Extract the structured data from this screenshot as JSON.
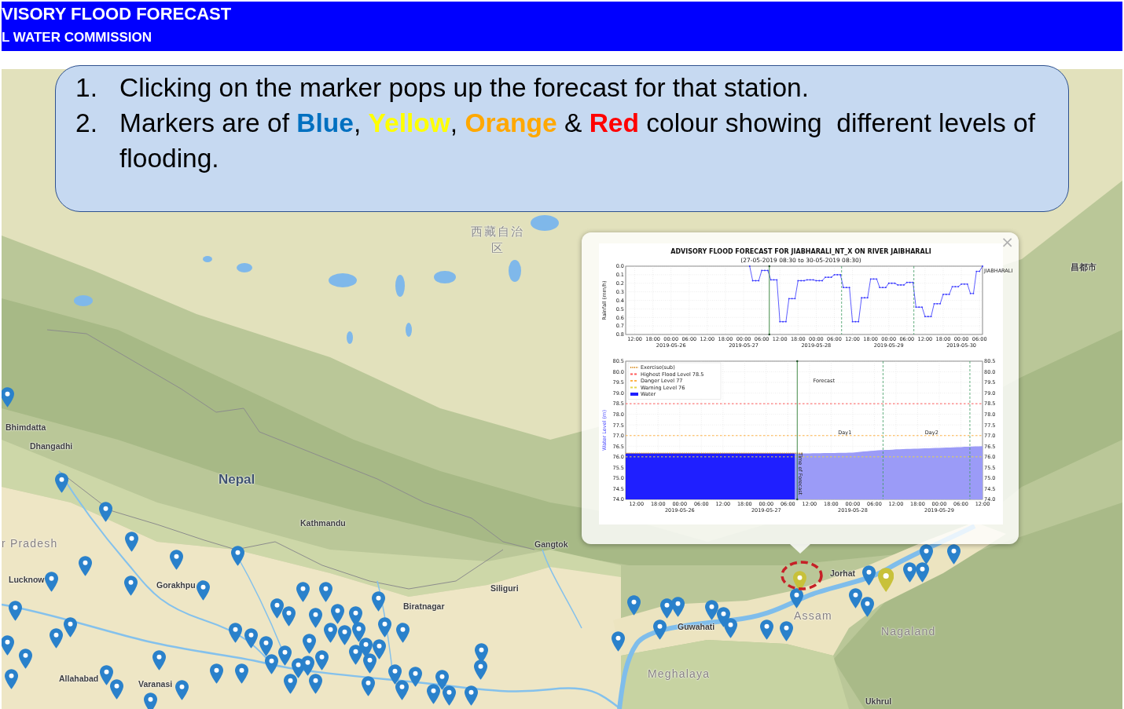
{
  "header": {
    "title": "VISORY FLOOD FORECAST",
    "subtitle": "L WATER COMMISSION"
  },
  "callout": {
    "items": [
      {
        "number": "1.",
        "segments": [
          {
            "text": "Clicking on the marker pops up the forecast for that station."
          }
        ]
      },
      {
        "number": "2.",
        "segments": [
          {
            "text": "Markers are of "
          },
          {
            "text": "**Blue**",
            "color": "#0070c0"
          },
          {
            "text": ", "
          },
          {
            "text": "**Yellow**",
            "color": "#ffff00"
          },
          {
            "text": ", "
          },
          {
            "text": "**Orange**",
            "color": "#ffa800"
          },
          {
            "text": " & "
          },
          {
            "text": "**Red**",
            "color": "#ff0000"
          },
          {
            "text": " colour showing  different levels of flooding."
          }
        ]
      }
    ]
  },
  "map": {
    "labels": [
      {
        "text": "西藏自治区",
        "kind": "region"
      },
      {
        "text": "昌都市",
        "kind": "city"
      },
      {
        "text": "Bhimdatta",
        "kind": "city"
      },
      {
        "text": "Dhangadhi",
        "kind": "city"
      },
      {
        "text": "Nepal",
        "kind": "country"
      },
      {
        "text": "Kathmandu",
        "kind": "city"
      },
      {
        "text": "r Pradesh",
        "kind": "state"
      },
      {
        "text": "Gangtok",
        "kind": "city"
      },
      {
        "text": "Lucknow",
        "kind": "city"
      },
      {
        "text": "Gorakhpu",
        "kind": "city"
      },
      {
        "text": "Jorhat",
        "kind": "city"
      },
      {
        "text": "Siliguri",
        "kind": "city"
      },
      {
        "text": "Biratnagar",
        "kind": "city"
      },
      {
        "text": "Assam",
        "kind": "state"
      },
      {
        "text": "Guwahati",
        "kind": "city"
      },
      {
        "text": "Nagaland",
        "kind": "state"
      },
      {
        "text": "Meghalaya",
        "kind": "state"
      },
      {
        "text": "Allahabad",
        "kind": "city"
      },
      {
        "text": "Varanasi",
        "kind": "city"
      },
      {
        "text": "Ukhrul",
        "kind": "city"
      }
    ],
    "markers": [
      {
        "color": "#2a81cb",
        "selected": false
      },
      {
        "color": "#2a81cb",
        "selected": false
      },
      {
        "color": "#2a81cb",
        "selected": false
      },
      {
        "color": "#2a81cb",
        "selected": false
      },
      {
        "color": "#2a81cb",
        "selected": false
      },
      {
        "color": "#2a81cb",
        "selected": false
      },
      {
        "color": "#2a81cb",
        "selected": false
      },
      {
        "color": "#2a81cb",
        "selected": false
      },
      {
        "color": "#2a81cb",
        "selected": false
      },
      {
        "color": "#2a81cb",
        "selected": false
      },
      {
        "color": "#2a81cb",
        "selected": false
      },
      {
        "color": "#2a81cb",
        "selected": false
      },
      {
        "color": "#2a81cb",
        "selected": false
      },
      {
        "color": "#2a81cb",
        "selected": false
      },
      {
        "color": "#2a81cb",
        "selected": false
      },
      {
        "color": "#2a81cb",
        "selected": false
      },
      {
        "color": "#2a81cb",
        "selected": false
      },
      {
        "color": "#2a81cb",
        "selected": false
      },
      {
        "color": "#2a81cb",
        "selected": false
      },
      {
        "color": "#2a81cb",
        "selected": false
      },
      {
        "color": "#2a81cb",
        "selected": false
      },
      {
        "color": "#2a81cb",
        "selected": false
      },
      {
        "color": "#2a81cb",
        "selected": false
      },
      {
        "color": "#2a81cb",
        "selected": false
      },
      {
        "color": "#2a81cb",
        "selected": false
      },
      {
        "color": "#2a81cb",
        "selected": false
      },
      {
        "color": "#2a81cb",
        "selected": false
      },
      {
        "color": "#2a81cb",
        "selected": false
      },
      {
        "color": "#2a81cb",
        "selected": false
      },
      {
        "color": "#2a81cb",
        "selected": false
      },
      {
        "color": "#2a81cb",
        "selected": false
      },
      {
        "color": "#2a81cb",
        "selected": false
      },
      {
        "color": "#2a81cb",
        "selected": false
      },
      {
        "color": "#2a81cb",
        "selected": false
      },
      {
        "color": "#2a81cb",
        "selected": false
      },
      {
        "color": "#2a81cb",
        "selected": false
      },
      {
        "color": "#2a81cb",
        "selected": false
      },
      {
        "color": "#2a81cb",
        "selected": false
      },
      {
        "color": "#2a81cb",
        "selected": false
      },
      {
        "color": "#2a81cb",
        "selected": false
      },
      {
        "color": "#2a81cb",
        "selected": false
      },
      {
        "color": "#2a81cb",
        "selected": false
      },
      {
        "color": "#2a81cb",
        "selected": false
      },
      {
        "color": "#2a81cb",
        "selected": false
      },
      {
        "color": "#2a81cb",
        "selected": false
      },
      {
        "color": "#2a81cb",
        "selected": false
      },
      {
        "color": "#2a81cb",
        "selected": false
      },
      {
        "color": "#2a81cb",
        "selected": false
      },
      {
        "color": "#2a81cb",
        "selected": false
      },
      {
        "color": "#2a81cb",
        "selected": false
      },
      {
        "color": "#2a81cb",
        "selected": false
      },
      {
        "color": "#2a81cb",
        "selected": false
      },
      {
        "color": "#2a81cb",
        "selected": false
      },
      {
        "color": "#2a81cb",
        "selected": false
      },
      {
        "color": "#2a81cb",
        "selected": false
      },
      {
        "color": "#2a81cb",
        "selected": false
      },
      {
        "color": "#2a81cb",
        "selected": false
      },
      {
        "color": "#2a81cb",
        "selected": false
      },
      {
        "color": "#2a81cb",
        "selected": false
      },
      {
        "color": "#2a81cb",
        "selected": false
      },
      {
        "color": "#2a81cb",
        "selected": false
      },
      {
        "color": "#2a81cb",
        "selected": false
      },
      {
        "color": "#2a81cb",
        "selected": false
      },
      {
        "color": "#2a81cb",
        "selected": false
      },
      {
        "color": "#2a81cb",
        "selected": false
      },
      {
        "color": "#2a81cb",
        "selected": false
      },
      {
        "color": "#2a81cb",
        "selected": false
      },
      {
        "color": "#2a81cb",
        "selected": false
      },
      {
        "color": "#2a81cb",
        "selected": false
      },
      {
        "color": "#2a81cb",
        "selected": false
      },
      {
        "color": "#2a81cb",
        "selected": false
      },
      {
        "color": "#2a81cb",
        "selected": false
      },
      {
        "color": "#c8c13a",
        "selected": true
      },
      {
        "color": "#2a81cb",
        "selected": false
      },
      {
        "color": "#c8c13a",
        "selected": false
      },
      {
        "color": "#2a81cb",
        "selected": false
      },
      {
        "color": "#2a81cb",
        "selected": false
      },
      {
        "color": "#2a81cb",
        "selected": false
      },
      {
        "color": "#2a81cb",
        "selected": false
      },
      {
        "color": "#2a81cb",
        "selected": false
      },
      {
        "color": "#2a81cb",
        "selected": false
      }
    ]
  },
  "popup": {
    "close": "×",
    "title": "ADVISORY FLOOD FORECAST FOR JIABHARALI_NT_X ON RIVER JAIBHARALI",
    "subtitle": "(27-05-2019 08:30 to 30-05-2019 08:30)",
    "rainfall_chart": {
      "chart_data": {
        "type": "line",
        "ylabel": "Rainfall (mm/h)",
        "grid": true,
        "categories": [
          null,
          null,
          null,
          "12:00",
          null,
          null,
          null,
          null,
          null,
          "18:00",
          null,
          null,
          null,
          null,
          null,
          "00:00\n2019-05-26",
          null,
          null,
          null,
          null,
          null,
          "06:00",
          null,
          null,
          null,
          null,
          null,
          "12:00",
          null,
          null,
          null,
          null,
          null,
          "18:00",
          null,
          null,
          null,
          null,
          null,
          "00:00\n2019-05-27",
          null,
          null,
          null,
          null,
          null,
          "06:00",
          null,
          null,
          null,
          null,
          null,
          "12:00",
          null,
          null,
          null,
          null,
          null,
          "18:00",
          null,
          null,
          null,
          null,
          null,
          "00:00\n2019-05-28",
          null,
          null,
          null,
          null,
          null,
          "06:00",
          null,
          null,
          null,
          null,
          null,
          "12:00",
          null,
          null,
          null,
          null,
          null,
          "18:00",
          null,
          null,
          null,
          null,
          null,
          "00:00\n2019-05-29",
          null,
          null,
          null,
          null,
          null,
          "06:00",
          null,
          null,
          null,
          null,
          null,
          "12:00",
          null,
          null,
          null,
          null,
          null,
          "18:00",
          null,
          null,
          null,
          null,
          null,
          "00:00\n2019-05-30",
          null,
          null,
          null,
          null,
          null,
          "06:00",
          null
        ],
        "series": [
          {
            "name": "JIABHARALI",
            "color": "#3333ff",
            "values": [
              null,
              null,
              null,
              null,
              null,
              null,
              null,
              null,
              null,
              null,
              null,
              null,
              null,
              null,
              null,
              null,
              null,
              null,
              null,
              null,
              null,
              null,
              null,
              null,
              null,
              null,
              null,
              null,
              null,
              null,
              null,
              null,
              null,
              null,
              null,
              null,
              null,
              null,
              null,
              null,
              null,
              0.0,
              0.17,
              0.17,
              0.17,
              0.05,
              0.05,
              0.05,
              0.16,
              0.16,
              0.16,
              0.65,
              0.65,
              0.65,
              0.38,
              0.38,
              0.38,
              0.17,
              0.17,
              0.17,
              0.16,
              0.16,
              0.16,
              0.17,
              0.17,
              0.17,
              0.13,
              0.13,
              0.13,
              0.1,
              0.1,
              0.1,
              0.25,
              0.25,
              0.25,
              0.65,
              0.65,
              0.65,
              0.37,
              0.37,
              0.37,
              0.15,
              0.15,
              0.15,
              0.25,
              0.25,
              0.25,
              0.2,
              0.2,
              0.2,
              0.22,
              0.22,
              0.22,
              0.19,
              0.19,
              0.19,
              0.48,
              0.48,
              0.48,
              0.59,
              0.59,
              0.59,
              0.44,
              0.44,
              0.44,
              0.33,
              0.33,
              0.33,
              0.24,
              0.24,
              0.24,
              0.21,
              0.21,
              0.21,
              0.32,
              0.32,
              0.06,
              0.06,
              0.0
            ]
          }
        ],
        "ylim": [
          0.8,
          0
        ],
        "yticks": [
          {
            "value": 0,
            "label": "0.0"
          },
          {
            "value": 0.1,
            "label": "0.1"
          },
          {
            "value": 0.2,
            "label": "0.2"
          },
          {
            "value": 0.3,
            "label": "0.3"
          },
          {
            "value": 0.4,
            "label": "0.4"
          },
          {
            "value": 0.5,
            "label": "0.5"
          },
          {
            "value": 0.6,
            "label": "0.6"
          },
          {
            "value": 0.7,
            "label": "0.7"
          },
          {
            "value": 0.8,
            "label": "0.8"
          }
        ]
      }
    },
    "water_level_chart": {
      "chart_data": {
        "type": "area",
        "ylabel": "Water Level (m)",
        "grid": true,
        "legend": "upper left",
        "categories": [
          null,
          null,
          null,
          "12:00",
          null,
          null,
          null,
          null,
          null,
          "18:00",
          null,
          null,
          null,
          null,
          null,
          "00:00\n2019-05-26",
          null,
          null,
          null,
          null,
          null,
          "06:00",
          null,
          null,
          null,
          null,
          null,
          "12:00",
          null,
          null,
          null,
          null,
          null,
          "18:00",
          null,
          null,
          null,
          null,
          null,
          "00:00\n2019-05-27",
          null,
          null,
          null,
          null,
          null,
          "06:00",
          null,
          null,
          null,
          null,
          null,
          "12:00",
          null,
          null,
          null,
          null,
          null,
          "18:00",
          null,
          null,
          null,
          null,
          null,
          "00:00\n2019-05-28",
          null,
          null,
          null,
          null,
          null,
          "06:00",
          null,
          null,
          null,
          null,
          null,
          "12:00",
          null,
          null,
          null,
          null,
          null,
          "18:00",
          null,
          null,
          null,
          null,
          null,
          "00:00\n2019-05-29",
          null,
          null,
          null,
          null,
          null,
          "06:00",
          null,
          null,
          null,
          null,
          null,
          "12:00"
        ],
        "series": [
          {
            "name": "Water",
            "type": "area",
            "color": "#1f1fff",
            "values": [
              76.17,
              76.17,
              76.17,
              76.17,
              76.17,
              76.17,
              76.17,
              76.17,
              76.17,
              76.17,
              76.17,
              76.17,
              76.17,
              76.17,
              76.17,
              76.17,
              76.17,
              76.17,
              76.17,
              76.17,
              76.17,
              76.17,
              76.17,
              76.17,
              76.17,
              76.17,
              76.17,
              76.17,
              76.17,
              76.17,
              76.17,
              76.17,
              76.17,
              76.17,
              76.17,
              76.17,
              76.17,
              76.17,
              76.17,
              76.17,
              76.17,
              76.17,
              76.17,
              76.17,
              76.17,
              76.17,
              76.17,
              76.17,
              null,
              null,
              null,
              null,
              null,
              null,
              null,
              null,
              null,
              null,
              null,
              null,
              null,
              null,
              null,
              null,
              null,
              null,
              null,
              null,
              null,
              null,
              null,
              null,
              null,
              null,
              null,
              null,
              null,
              null,
              null,
              null,
              null,
              null,
              null,
              null,
              null,
              null,
              null,
              null,
              null,
              null,
              null,
              null,
              null,
              null,
              null,
              null,
              null,
              null,
              null,
              null
            ]
          },
          {
            "type": "area",
            "color": "#9b9bf7",
            "values": [
              null,
              null,
              null,
              null,
              null,
              null,
              null,
              null,
              null,
              null,
              null,
              null,
              null,
              null,
              null,
              null,
              null,
              null,
              null,
              null,
              null,
              null,
              null,
              null,
              null,
              null,
              null,
              null,
              null,
              null,
              null,
              null,
              null,
              null,
              null,
              null,
              null,
              null,
              null,
              null,
              null,
              null,
              null,
              null,
              null,
              null,
              null,
              76.15,
              76.15,
              76.16,
              76.16,
              76.16,
              76.17,
              76.17,
              76.17,
              76.18,
              76.18,
              76.18,
              76.18,
              76.19,
              76.19,
              76.19,
              76.2,
              76.2,
              76.22,
              76.23,
              76.25,
              76.26,
              76.28,
              76.29,
              76.31,
              76.32,
              76.33,
              76.33,
              76.34,
              76.35,
              76.35,
              76.36,
              76.37,
              76.37,
              76.38,
              76.38,
              76.39,
              76.4,
              76.4,
              76.41,
              76.42,
              76.42,
              76.43,
              76.44,
              76.44,
              76.45,
              76.46,
              76.46,
              76.47,
              76.47,
              76.48,
              76.49,
              76.49,
              76.5
            ]
          },
          {
            "name": "Exercise(sub)",
            "type": "line",
            "line_style": "dotted",
            "color": "#d9912a",
            "values": [
              76.17,
              76.17,
              76.17,
              76.17,
              76.17,
              76.17,
              76.17,
              76.17,
              76.17,
              76.17,
              76.17,
              76.17,
              76.17,
              76.17,
              76.17,
              76.17,
              76.17,
              76.17,
              76.17,
              76.17,
              76.17,
              76.17,
              76.17,
              76.17,
              76.17,
              76.17,
              76.17,
              76.17,
              76.17,
              76.17,
              76.17,
              76.17,
              76.17,
              76.17,
              76.17,
              76.17,
              76.17,
              76.17,
              76.17,
              76.17,
              76.17,
              76.17,
              76.17,
              76.17,
              76.17,
              76.17,
              76.17,
              76.17,
              76.17,
              76.17,
              null,
              null,
              null,
              null,
              null,
              null,
              null,
              null,
              null,
              null,
              null,
              null,
              null,
              null,
              null,
              null,
              null,
              null,
              null,
              null,
              null,
              null,
              null,
              null,
              null,
              null,
              null,
              null,
              null,
              null,
              null,
              null,
              null,
              null,
              null,
              null,
              null,
              null,
              null,
              null,
              null,
              null,
              null,
              null,
              null,
              null,
              null,
              null,
              null,
              null
            ]
          }
        ],
        "ylim": [
          74,
          80.5
        ],
        "yticks": [
          {
            "value": 74,
            "label": "74.0"
          },
          {
            "value": 74.5,
            "label": "74.5"
          },
          {
            "value": 75,
            "label": "75.0"
          },
          {
            "value": 75.5,
            "label": "75.5"
          },
          {
            "value": 76,
            "label": "76.0"
          },
          {
            "value": 76.5,
            "label": "76.5"
          },
          {
            "value": 77,
            "label": "77.0"
          },
          {
            "value": 77.5,
            "label": "77.5"
          },
          {
            "value": 78,
            "label": "78.0"
          },
          {
            "value": 78.5,
            "label": "78.5"
          },
          {
            "value": 79,
            "label": "79.0"
          },
          {
            "value": 79.5,
            "label": "79.5"
          },
          {
            "value": 80,
            "label": "80.0"
          },
          {
            "value": 80.5,
            "label": "80.5"
          }
        ],
        "ref_lines": [
          {
            "axis": "y",
            "value": 78.5,
            "label": "Highest Flood Level 78.5",
            "color": "#ff5a5a"
          },
          {
            "axis": "y",
            "value": 77,
            "label": "Danger Level 77",
            "color": "#ffb347"
          },
          {
            "axis": "y",
            "value": 76,
            "label": "Warning Level 76",
            "color": "#e6d54a"
          }
        ],
        "annotations": [
          "Forecast",
          "Day1",
          "Day2",
          "Time of Forecast"
        ]
      }
    }
  }
}
